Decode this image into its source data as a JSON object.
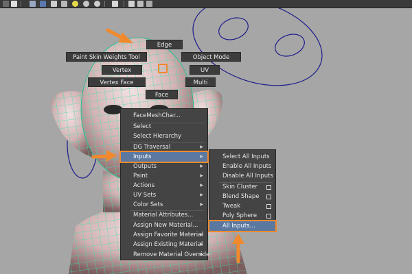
{
  "marking_menu": {
    "edge": "Edge",
    "paint_skin": "Paint Skin Weights Tool",
    "object_mode": "Object Mode",
    "vertex": "Vertex",
    "uv": "UV",
    "vertex_face": "Vertex Face",
    "multi": "Multi",
    "face": "Face"
  },
  "context_menu": {
    "items": [
      {
        "label": "FaceMeshChar..."
      },
      {
        "label": "Select"
      },
      {
        "label": "Select Hierarchy"
      },
      {
        "label": "DG Traversal"
      },
      {
        "label": "Inputs"
      },
      {
        "label": "Outputs"
      },
      {
        "label": "Paint"
      },
      {
        "label": "Actions"
      },
      {
        "label": "UV Sets"
      },
      {
        "label": "Color Sets"
      },
      {
        "label": "Material Attributes..."
      },
      {
        "label": "Assign New Material..."
      },
      {
        "label": "Assign Favorite Material"
      },
      {
        "label": "Assign Existing Material"
      },
      {
        "label": "Remove Material Override"
      }
    ]
  },
  "inputs_submenu": {
    "items": [
      {
        "label": "Select All Inputs"
      },
      {
        "label": "Enable All Inputs"
      },
      {
        "label": "Disable All Inputs"
      },
      {
        "label": "Skin Cluster"
      },
      {
        "label": "Blend Shape"
      },
      {
        "label": "Tweak"
      },
      {
        "label": "Poly Sphere"
      },
      {
        "label": "All Inputs..."
      }
    ]
  },
  "colors": {
    "viewport": "#a6a6a6",
    "menu_bg": "#444444",
    "highlight": "#5b79a0",
    "callout": "#f08a2c",
    "wire": "#3de0b0"
  },
  "icons": [
    "toggle-icon",
    "text-icon",
    "cube-icon",
    "shading-icon",
    "checker-icon",
    "light-icon",
    "sphere-icon",
    "select-icon",
    "camera-icon",
    "node-icon"
  ]
}
